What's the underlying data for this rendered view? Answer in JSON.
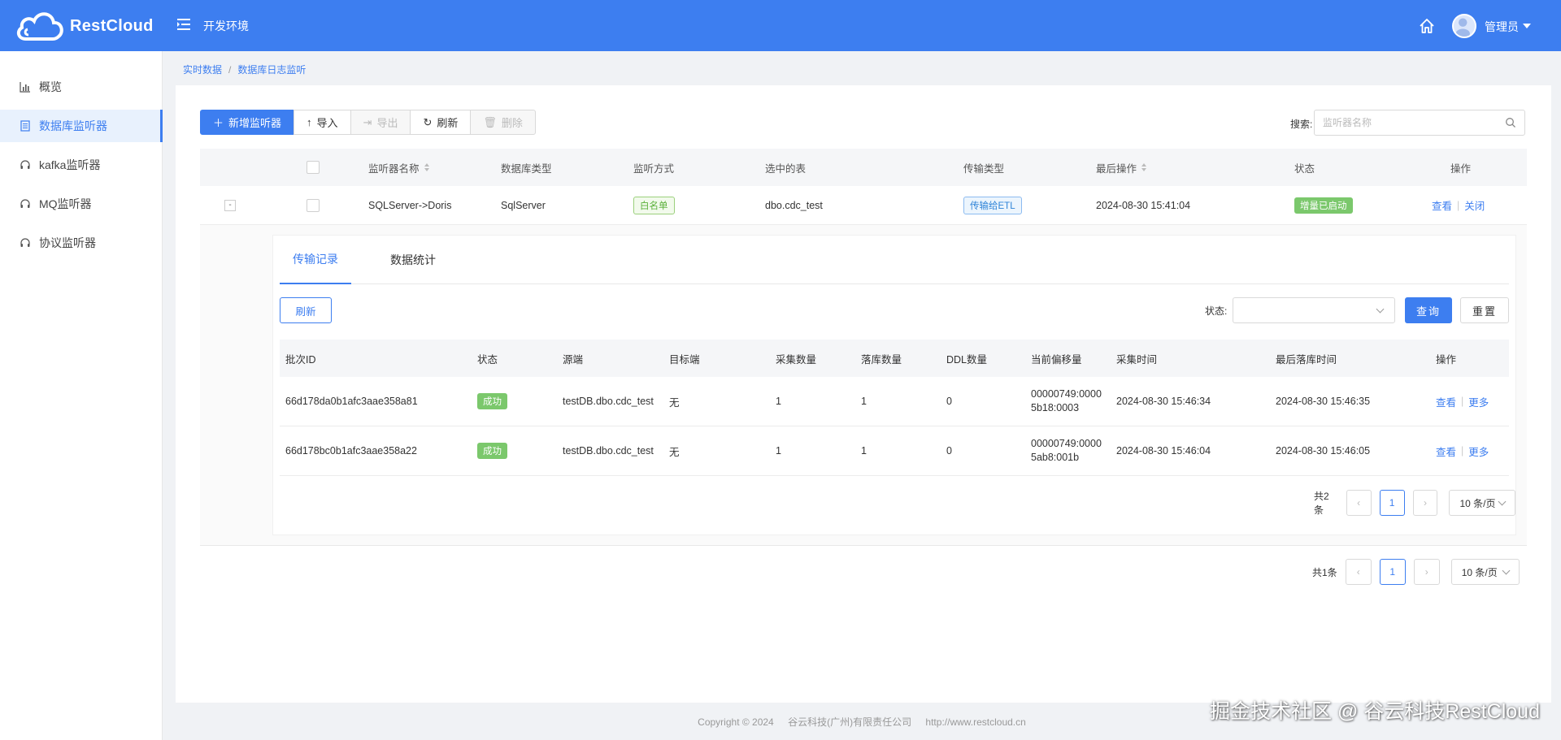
{
  "header": {
    "logo_text": "RestCloud",
    "env_title": "开发环境",
    "user_name": "管理员"
  },
  "sidebar": {
    "items": [
      {
        "label": "概览",
        "icon": "bar-chart-icon"
      },
      {
        "label": "数据库监听器",
        "icon": "document-icon",
        "active": true
      },
      {
        "label": "kafka监听器",
        "icon": "headset-icon"
      },
      {
        "label": "MQ监听器",
        "icon": "headset-icon"
      },
      {
        "label": "协议监听器",
        "icon": "headset-icon"
      }
    ]
  },
  "breadcrumb": {
    "parent": "实时数据",
    "current": "数据库日志监听"
  },
  "toolbar": {
    "add_label": "新增监听器",
    "import_label": "导入",
    "export_label": "导出",
    "refresh_label": "刷新",
    "delete_label": "删除"
  },
  "search": {
    "label": "搜索:",
    "placeholder": "监听器名称"
  },
  "listener_table": {
    "headers": {
      "name": "监听器名称",
      "db_type": "数据库类型",
      "mode": "监听方式",
      "table": "选中的表",
      "transfer": "传输类型",
      "last_op": "最后操作",
      "status": "状态",
      "action": "操作"
    },
    "rows": [
      {
        "expand": "-",
        "name": "SQLServer->Doris",
        "db_type": "SqlServer",
        "mode": "白名单",
        "table": "dbo.cdc_test",
        "transfer": "传输给ETL",
        "last_op": "2024-08-30 15:41:04",
        "status": "增量已启动",
        "view": "查看",
        "close": "关闭"
      }
    ]
  },
  "detail": {
    "tabs": [
      "传输记录",
      "数据统计"
    ],
    "refresh_label": "刷新",
    "status_label": "状态:",
    "status_value": "",
    "query_label": "查询",
    "reset_label": "重置",
    "headers": {
      "batch_id": "批次ID",
      "status": "状态",
      "source": "源端",
      "target": "目标端",
      "collected": "采集数量",
      "landed": "落库数量",
      "ddl": "DDL数量",
      "offset": "当前偏移量",
      "collect_time": "采集时间",
      "land_time": "最后落库时间",
      "action": "操作"
    },
    "rows": [
      {
        "batch_id": "66d178da0b1afc3aae358a81",
        "status": "成功",
        "source": "testDB.dbo.cdc_test",
        "target": "无",
        "collected": "1",
        "landed": "1",
        "ddl": "0",
        "offset_1": "00000749:0000",
        "offset_2": "5b18:0003",
        "collect_time": "2024-08-30 15:46:34",
        "land_time": "2024-08-30 15:46:35",
        "view": "查看",
        "more": "更多"
      },
      {
        "batch_id": "66d178bc0b1afc3aae358a22",
        "status": "成功",
        "source": "testDB.dbo.cdc_test",
        "target": "无",
        "collected": "1",
        "landed": "1",
        "ddl": "0",
        "offset_1": "00000749:0000",
        "offset_2": "5ab8:001b",
        "collect_time": "2024-08-30 15:46:04",
        "land_time": "2024-08-30 15:46:05",
        "view": "查看",
        "more": "更多"
      }
    ],
    "pager": {
      "total": "共2条",
      "page": "1",
      "size": "10 条/页"
    }
  },
  "outer_pager": {
    "total": "共1条",
    "page": "1",
    "size": "10 条/页"
  },
  "footer": {
    "copyright": "Copyright © 2024",
    "company": "谷云科技(广州)有限责任公司",
    "url": "http://www.restcloud.cn"
  },
  "watermark": "掘金技术社区 @ 谷云科技RestCloud",
  "colors": {
    "primary": "#3d7ef0",
    "success": "#7bc86c",
    "background": "#f0f2f5"
  }
}
